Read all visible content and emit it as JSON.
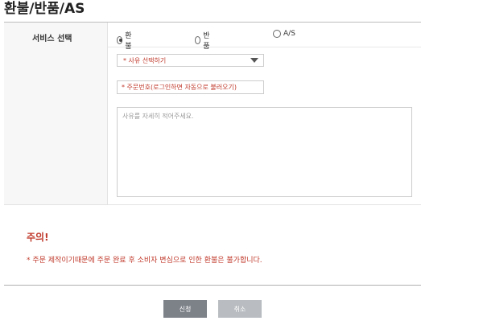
{
  "page": {
    "title": "환불/반품/AS"
  },
  "form": {
    "service_label": "서비스 선택",
    "options": [
      {
        "label": "환불",
        "checked": true
      },
      {
        "label": "반품",
        "checked": false
      },
      {
        "label": "A/S",
        "checked": false
      }
    ],
    "reason_select": "* 사유 선택하기",
    "order_placeholder": "* 주문번호(로그인하면 자동으로 불러오기)",
    "detail_placeholder": "사유를 자세히 적어주세요."
  },
  "notice": {
    "title": "주의!",
    "text": "* 주문 제작이기때문에 주문 완료 후 소비자 변심으로 인한 환불은 불가합니다."
  },
  "buttons": {
    "submit": "신청",
    "cancel": "취소"
  },
  "colors": {
    "accent": "#c0392b",
    "submit_bg": "#7d8289",
    "cancel_bg": "#b9bdc1"
  }
}
